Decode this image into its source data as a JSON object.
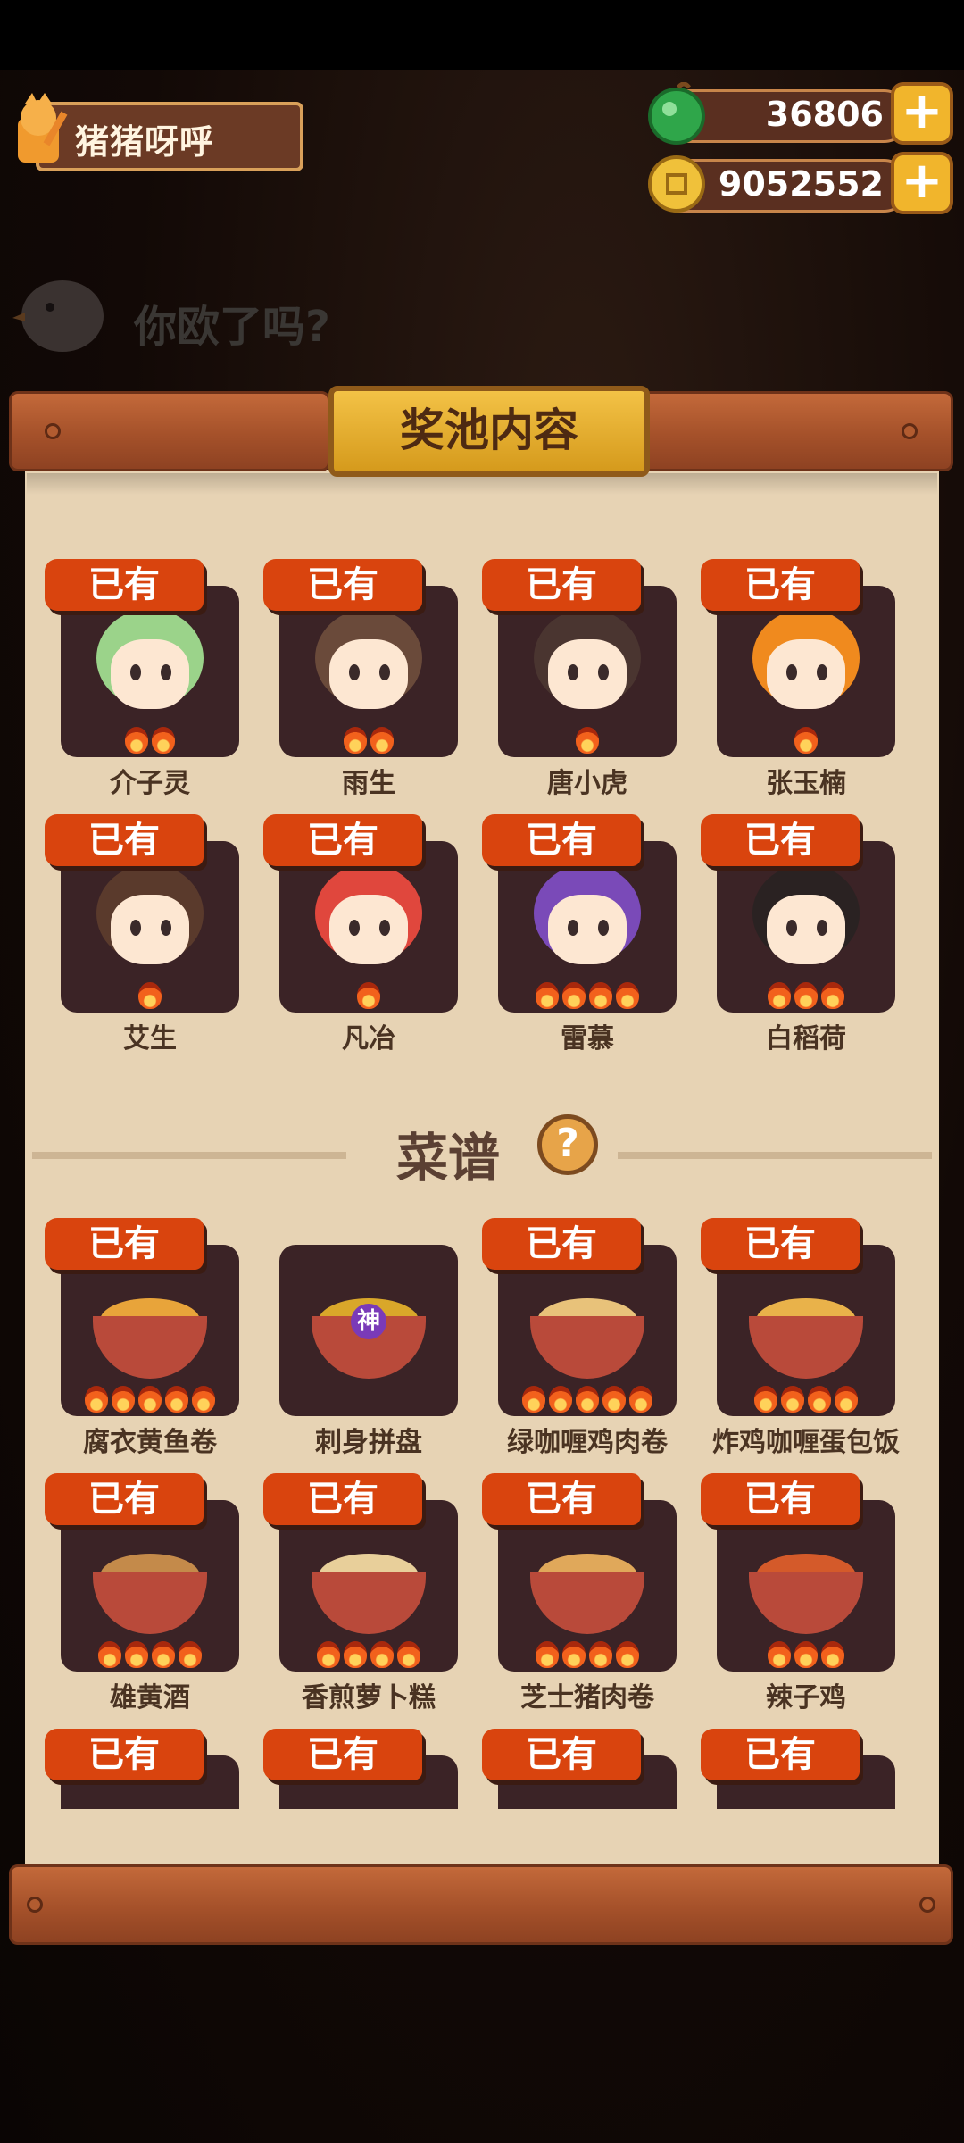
{
  "player": {
    "name": "猪猪呀呼"
  },
  "currencies": [
    {
      "icon": "green-gem-icon",
      "value": "36806"
    },
    {
      "icon": "gold-coin-icon",
      "value": "9052552"
    }
  ],
  "background_slogan": "你欧了吗?",
  "panel": {
    "title": "奖池内容"
  },
  "owned_label": "已有",
  "characters": [
    {
      "name": "介子灵",
      "owned": true,
      "stars": 2,
      "hair": "#9bd38a"
    },
    {
      "name": "雨生",
      "owned": true,
      "stars": 2,
      "hair": "#6a4a3a"
    },
    {
      "name": "唐小虎",
      "owned": true,
      "stars": 1,
      "hair": "#4a3530"
    },
    {
      "name": "张玉楠",
      "owned": true,
      "stars": 1,
      "hair": "#f08a1e"
    },
    {
      "name": "艾生",
      "owned": true,
      "stars": 1,
      "hair": "#5a3a2c"
    },
    {
      "name": "凡冶",
      "owned": true,
      "stars": 1,
      "hair": "#e0473d"
    },
    {
      "name": "雷慕",
      "owned": true,
      "stars": 4,
      "hair": "#7a4ab8"
    },
    {
      "name": "白稻荷",
      "owned": true,
      "stars": 3,
      "hair": "#2a2222"
    }
  ],
  "recipes_section": {
    "title": "菜谱",
    "help": "?"
  },
  "recipes": [
    {
      "name": "腐衣黄鱼卷",
      "owned": true,
      "stars": 5,
      "color": "#e8a43a",
      "badge": ""
    },
    {
      "name": "刺身拼盘",
      "owned": false,
      "stars": 0,
      "color": "#d9a72a",
      "badge": "神"
    },
    {
      "name": "绿咖喱鸡肉卷",
      "owned": true,
      "stars": 5,
      "color": "#e8c27a",
      "badge": ""
    },
    {
      "name": "炸鸡咖喱蛋包饭",
      "owned": true,
      "stars": 4,
      "color": "#e9b24a",
      "badge": ""
    },
    {
      "name": "雄黄酒",
      "owned": true,
      "stars": 4,
      "color": "#c48a4a",
      "badge": ""
    },
    {
      "name": "香煎萝卜糕",
      "owned": true,
      "stars": 4,
      "color": "#e8cf9a",
      "badge": ""
    },
    {
      "name": "芝士猪肉卷",
      "owned": true,
      "stars": 4,
      "color": "#e0a85a",
      "badge": ""
    },
    {
      "name": "辣子鸡",
      "owned": true,
      "stars": 3,
      "color": "#d45a2a",
      "badge": ""
    }
  ],
  "partial_row_owned": 4
}
